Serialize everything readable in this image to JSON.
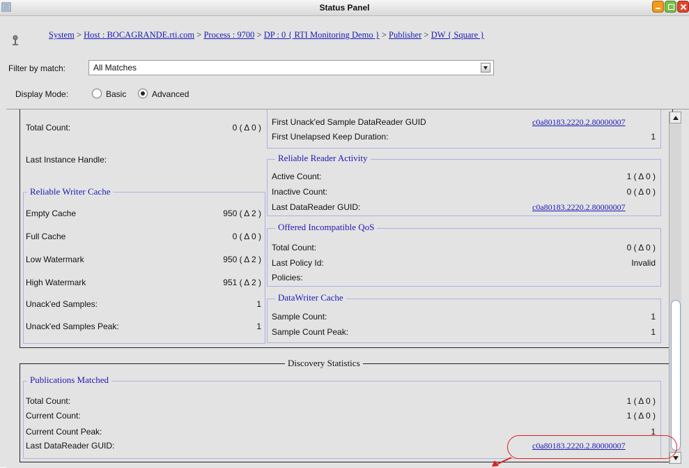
{
  "window": {
    "title": "Status Panel"
  },
  "breadcrumb": {
    "items": [
      {
        "text": "System",
        "link": true
      },
      {
        "text": " > ",
        "link": false
      },
      {
        "text": "Host : BOCAGRANDE.rti.com",
        "link": true
      },
      {
        "text": " > ",
        "link": false
      },
      {
        "text": "Process : 9700",
        "link": true
      },
      {
        "text": " > ",
        "link": false
      },
      {
        "text": "DP : 0 { RTI Monitoring Demo }",
        "link": true
      },
      {
        "text": " > ",
        "link": false
      },
      {
        "text": "Publisher",
        "link": true
      },
      {
        "text": " > ",
        "link": false
      },
      {
        "text": "DW { Square }",
        "link": true
      }
    ]
  },
  "filter": {
    "label": "Filter by match:",
    "value": "All Matches"
  },
  "display_mode": {
    "label": "Display Mode:",
    "options": [
      "Basic",
      "Advanced"
    ],
    "selected": "Advanced"
  },
  "left_col": {
    "total_count": {
      "label": "Total Count:",
      "value": "0  ( Δ 0 )"
    },
    "last_instance_handle": {
      "label": "Last Instance Handle:",
      "value": ""
    },
    "reliable_writer_cache": {
      "title": "Reliable Writer Cache",
      "rows": [
        {
          "label": "Empty Cache",
          "value": "950  ( Δ 2 )"
        },
        {
          "label": "Full Cache",
          "value": "0  ( Δ 0 )"
        },
        {
          "label": "Low Watermark",
          "value": "950  ( Δ 2 )"
        },
        {
          "label": "High Watermark",
          "value": "951  ( Δ 2 )"
        },
        {
          "label": "Unack'ed Samples:",
          "value": "1"
        },
        {
          "label": "Unack'ed Samples Peak:",
          "value": "1"
        }
      ]
    }
  },
  "right_col": {
    "first_unacked": {
      "label": "First Unack'ed Sample DataReader GUID",
      "value": "c0a80183.2220.2.80000007"
    },
    "first_unelapsed": {
      "label": "First Unelapsed Keep Duration:",
      "value": "1"
    },
    "reliable_reader_activity": {
      "title": "Reliable Reader Activity",
      "active": {
        "label": "Active Count:",
        "value": "1  ( Δ 0 )"
      },
      "inactive": {
        "label": "Inactive Count:",
        "value": "0  ( Δ 0 )"
      },
      "last_guid": {
        "label": "Last DataReader GUID:",
        "value": "c0a80183.2220.2.80000007"
      }
    },
    "offered_incompatible_qos": {
      "title": "Offered Incompatible QoS",
      "total": {
        "label": "Total Count:",
        "value": "0  ( Δ 0 )"
      },
      "last_policy": {
        "label": "Last Policy Id:",
        "value": "Invalid"
      },
      "policies": {
        "label": "Policies:",
        "value": ""
      }
    },
    "datawriter_cache": {
      "title": "DataWriter Cache",
      "sample_count": {
        "label": "Sample Count:",
        "value": "1"
      },
      "sample_count_peak": {
        "label": "Sample Count Peak:",
        "value": "1"
      }
    }
  },
  "discovery": {
    "title": "Discovery Statistics",
    "publications_matched": {
      "title": "Publications Matched",
      "total": {
        "label": "Total Count:",
        "value": "1  ( Δ 0 )"
      },
      "current": {
        "label": "Current Count:",
        "value": "1  ( Δ 0 )"
      },
      "current_peak": {
        "label": "Current Count Peak:",
        "value": "1"
      },
      "last_guid": {
        "label": "Last DataReader GUID:",
        "value": "c0a80183.2220.2.80000007"
      }
    }
  },
  "colors": {
    "link": "#1a1ab8",
    "panel_bg": "#e3e3e3",
    "group_border": "#aab0e8",
    "annotation": "#e02020"
  },
  "icons": [
    "window-menu-icon",
    "pin-icon",
    "minimize-icon",
    "maximize-icon",
    "close-icon",
    "dropdown-arrow-icon",
    "scroll-up-icon",
    "scroll-down-icon",
    "annotation-arrow-icon"
  ]
}
